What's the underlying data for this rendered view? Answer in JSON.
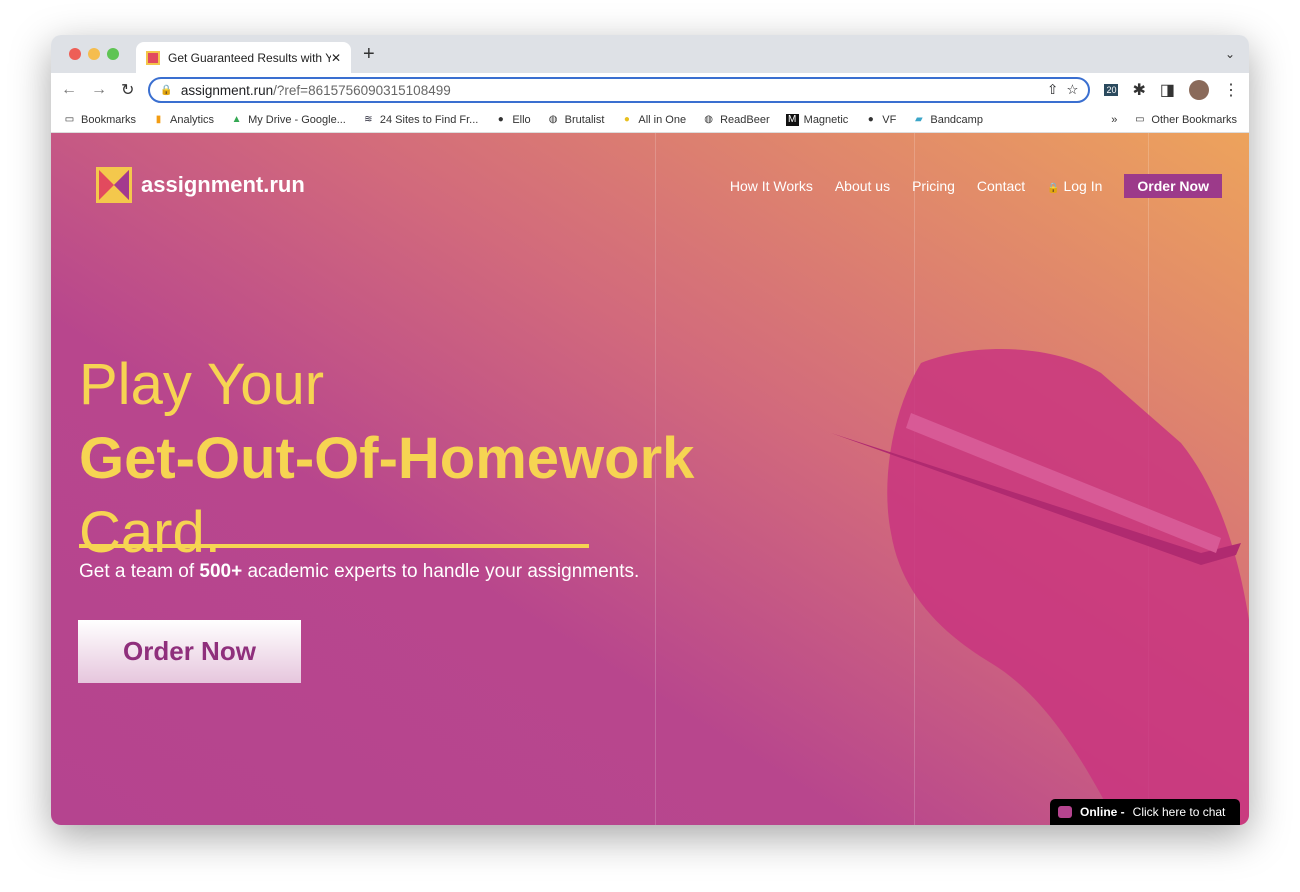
{
  "browser": {
    "tab_title": "Get Guaranteed Results with Yo",
    "url_host": "assignment.run",
    "url_path": "/?ref=8615756090315108499",
    "bookmarks": [
      {
        "label": "Bookmarks",
        "icon": "folder-icon"
      },
      {
        "label": "Analytics",
        "icon": "analytics-icon"
      },
      {
        "label": "My Drive - Google...",
        "icon": "google-drive-icon"
      },
      {
        "label": "24 Sites to Find Fr...",
        "icon": "layers-icon"
      },
      {
        "label": "Ello",
        "icon": "ello-icon"
      },
      {
        "label": "Brutalist",
        "icon": "globe-icon"
      },
      {
        "label": "All in One",
        "icon": "all-in-one-icon"
      },
      {
        "label": "ReadBeer",
        "icon": "globe-icon"
      },
      {
        "label": "Magnetic",
        "icon": "magnetic-icon"
      },
      {
        "label": "VF",
        "icon": "vf-icon"
      },
      {
        "label": "Bandcamp",
        "icon": "bandcamp-icon"
      }
    ],
    "other_bookmarks": "Other Bookmarks",
    "overflow": "»",
    "calendar_badge": "20"
  },
  "site": {
    "logo": "assignment.run",
    "nav": [
      "How It Works",
      "About us",
      "Pricing",
      "Contact",
      "Log In"
    ],
    "nav_cta": "Order Now",
    "headline_1": "Play Your",
    "headline_2": "Get-Out-Of-Homework",
    "headline_3": "Card.",
    "sub_pre": "Get a team of ",
    "sub_bold": "500+",
    "sub_post": " academic experts to handle your assignments.",
    "cta": "Order Now",
    "chat_status": "Online -",
    "chat_text": "Click here to chat"
  },
  "colors": {
    "accent_yellow": "#f6d452",
    "purple": "#b5448f",
    "orange": "#eda35c"
  }
}
